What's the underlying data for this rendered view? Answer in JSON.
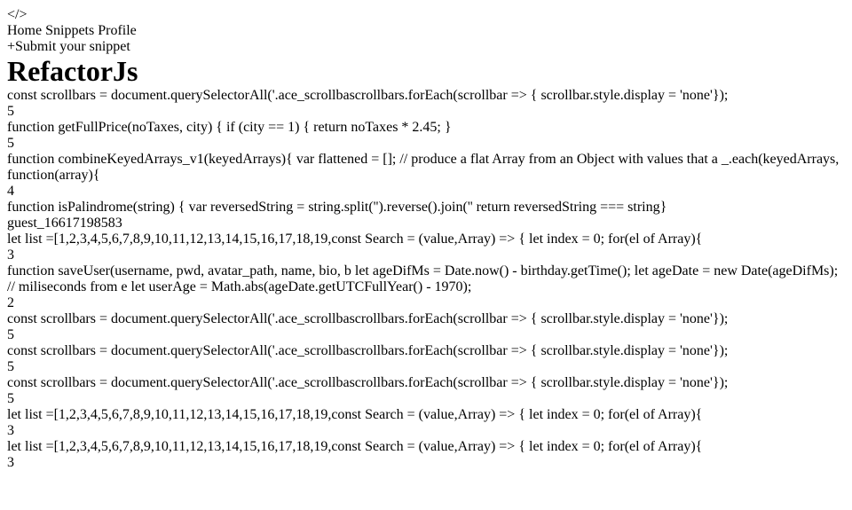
{
  "app": {
    "logo_glyph": "</>",
    "nav": [
      "Home",
      "Snippets",
      "Profile"
    ],
    "active_nav": "Home",
    "submit_button": "Submit your snippet",
    "page_title": "RefactorJs"
  },
  "colors": {
    "accent": "#4f46e5",
    "hero_bg": "#1f2937",
    "page_bg": "#e7e8eb",
    "keyword": "#1d4ed8",
    "string": "#047857",
    "number": "#b45309"
  },
  "snippets": [
    {
      "code": [
        [
          [
            "const ",
            "kw"
          ],
          [
            "scrollbars = ",
            ""
          ],
          [
            "document",
            "fn"
          ],
          [
            ".querySelectorAll('.ace_scrollba",
            ""
          ]
        ],
        [],
        [
          [
            "scrollbars.forEach(scrollbar => {",
            ""
          ]
        ],
        [
          [
            "  scrollbar.",
            ""
          ],
          [
            "style",
            "fn"
          ],
          [
            ".",
            ""
          ],
          [
            "display",
            "fn"
          ],
          [
            " = ",
            ""
          ],
          [
            "'none'",
            "str"
          ]
        ],
        [
          [
            "});",
            ""
          ]
        ]
      ],
      "author": "",
      "author_blurred": true,
      "comments": "5"
    },
    {
      "code": [
        [
          [
            "function ",
            "kw"
          ],
          [
            "getFullPrice",
            "fn"
          ],
          [
            "(",
            ""
          ],
          [
            "noTaxes, city",
            "fn"
          ],
          [
            ") {",
            ""
          ]
        ],
        [
          [
            "  if (city == 1) {",
            ""
          ]
        ],
        [
          [
            "    return ",
            "kw"
          ],
          [
            "noTaxes * ",
            ""
          ],
          [
            "2.45",
            "num"
          ],
          [
            ";",
            ""
          ]
        ],
        [
          [
            "  }",
            ""
          ]
        ]
      ],
      "author": "",
      "author_blurred": true,
      "comments": "5"
    },
    {
      "code": [
        [
          [
            "function ",
            "kw"
          ],
          [
            "combineKeyedArrays_v1",
            "fn"
          ],
          [
            "(",
            ""
          ],
          [
            "keyedArrays",
            "fn"
          ],
          [
            "){",
            ""
          ]
        ],
        [
          [
            "  var ",
            "kw"
          ],
          [
            "flattened = [];",
            ""
          ]
        ],
        [],
        [
          [
            "  // produce a flat Array from an Object with values that a",
            "cm"
          ]
        ],
        [
          [
            "  _.each(keyedArrays, ",
            ""
          ],
          [
            "function",
            "kw"
          ],
          [
            "(array){",
            ""
          ]
        ]
      ],
      "author": "",
      "author_blurred": true,
      "comments": "4"
    },
    {
      "code": [
        [
          [
            "function ",
            "kw"
          ],
          [
            "isPalindrome",
            "fn"
          ],
          [
            "(",
            ""
          ],
          [
            "string",
            "fn"
          ],
          [
            ") {",
            ""
          ]
        ],
        [
          [
            "    var ",
            "kw"
          ],
          [
            "reversedString = string.",
            ""
          ],
          [
            "split",
            "fn"
          ],
          [
            "('').",
            ""
          ],
          [
            "reverse",
            "fn"
          ],
          [
            "().",
            ""
          ],
          [
            "join",
            "fn"
          ],
          [
            "(''",
            ""
          ]
        ],
        [
          [
            "    return ",
            "kw"
          ],
          [
            "reversedString === string",
            ""
          ]
        ],
        [
          [
            "}",
            ""
          ]
        ]
      ],
      "author": "guest_1661719858",
      "author_blurred": false,
      "comments": "3"
    },
    {
      "code": [
        [
          [
            "let ",
            "kw"
          ],
          [
            "list =[",
            ""
          ],
          [
            "1,2,3,4,5,6,7,8,9,10,11,12,13,14,15,16,17,18,19,",
            "num"
          ]
        ],
        [],
        [
          [
            "const ",
            "kw"
          ],
          [
            "Search = (value,",
            ""
          ],
          [
            "Array",
            "fn"
          ],
          [
            ") => {",
            ""
          ]
        ],
        [
          [
            " let ",
            "kw"
          ],
          [
            "index = ",
            ""
          ],
          [
            "0",
            "num"
          ],
          [
            ";",
            ""
          ]
        ],
        [
          [
            "  for(el ",
            ""
          ],
          [
            "of ",
            "kw"
          ],
          [
            "Array",
            "fn"
          ],
          [
            "){",
            ""
          ]
        ]
      ],
      "author": "",
      "author_blurred": true,
      "comments": "3"
    },
    {
      "code": [
        [
          [
            "  function ",
            "kw"
          ],
          [
            "saveUser",
            "fn"
          ],
          [
            "(",
            ""
          ],
          [
            "username, pwd, avatar_path, name, bio, b",
            "fn"
          ]
        ],
        [
          [
            "    let ",
            "kw"
          ],
          [
            "ageDifMs = ",
            ""
          ],
          [
            "Date",
            "fn"
          ],
          [
            ".now() - birthday.",
            ""
          ],
          [
            "getTime",
            "fn"
          ],
          [
            "();",
            ""
          ]
        ],
        [
          [
            "    let ",
            "kw"
          ],
          [
            "ageDate = ",
            ""
          ],
          [
            "new ",
            "kw"
          ],
          [
            "Date",
            "fn"
          ],
          [
            "(ageDifMs); ",
            ""
          ],
          [
            "// miliseconds from e",
            "cm"
          ]
        ],
        [
          [
            "    let ",
            "kw"
          ],
          [
            "userAge = ",
            ""
          ],
          [
            "Math",
            "fn"
          ],
          [
            ".",
            ""
          ],
          [
            "abs",
            "fn"
          ],
          [
            "(ageDate.",
            ""
          ],
          [
            "getUTCFullYear",
            "fn"
          ],
          [
            "() - ",
            ""
          ],
          [
            "1970",
            "num"
          ],
          [
            ");",
            ""
          ]
        ]
      ],
      "author": "",
      "author_blurred": true,
      "comments": "2"
    },
    {
      "code": [
        [
          [
            "const ",
            "kw"
          ],
          [
            "scrollbars = ",
            ""
          ],
          [
            "document",
            "fn"
          ],
          [
            ".querySelectorAll('.ace_scrollba",
            ""
          ]
        ],
        [],
        [
          [
            "scrollbars.forEach(scrollbar => {",
            ""
          ]
        ],
        [
          [
            "  scrollbar.",
            ""
          ],
          [
            "style",
            "fn"
          ],
          [
            ".",
            ""
          ],
          [
            "display",
            "fn"
          ],
          [
            " = ",
            ""
          ],
          [
            "'none'",
            "str"
          ]
        ],
        [
          [
            "});",
            ""
          ]
        ]
      ],
      "author": "",
      "author_blurred": true,
      "comments": "5"
    },
    {
      "code": [
        [
          [
            "const ",
            "kw"
          ],
          [
            "scrollbars = ",
            ""
          ],
          [
            "document",
            "fn"
          ],
          [
            ".querySelectorAll('.ace_scrollba",
            ""
          ]
        ],
        [],
        [
          [
            "scrollbars.forEach(scrollbar => {",
            ""
          ]
        ],
        [
          [
            "  scrollbar.",
            ""
          ],
          [
            "style",
            "fn"
          ],
          [
            ".",
            ""
          ],
          [
            "display",
            "fn"
          ],
          [
            " = ",
            ""
          ],
          [
            "'none'",
            "str"
          ]
        ],
        [
          [
            "});",
            ""
          ]
        ]
      ],
      "author": "",
      "author_blurred": true,
      "comments": "5"
    },
    {
      "code": [
        [
          [
            "const ",
            "kw"
          ],
          [
            "scrollbars = ",
            ""
          ],
          [
            "document",
            "fn"
          ],
          [
            ".querySelectorAll('.ace_scrollba",
            ""
          ]
        ],
        [],
        [
          [
            "scrollbars.forEach(scrollbar => {",
            ""
          ]
        ],
        [
          [
            "  scrollbar.",
            ""
          ],
          [
            "style",
            "fn"
          ],
          [
            ".",
            ""
          ],
          [
            "display",
            "fn"
          ],
          [
            " = ",
            ""
          ],
          [
            "'none'",
            "str"
          ]
        ],
        [
          [
            "});",
            ""
          ]
        ]
      ],
      "author": "",
      "author_blurred": true,
      "comments": "5"
    },
    {
      "code": [
        [
          [
            "let ",
            "kw"
          ],
          [
            "list =[",
            ""
          ],
          [
            "1,2,3,4,5,6,7,8,9,10,11,12,13,14,15,16,17,18,19,",
            "num"
          ]
        ],
        [],
        [
          [
            "const ",
            "kw"
          ],
          [
            "Search = (value,",
            ""
          ],
          [
            "Array",
            "fn"
          ],
          [
            ") => {",
            ""
          ]
        ],
        [
          [
            " let ",
            "kw"
          ],
          [
            "index = ",
            ""
          ],
          [
            "0",
            "num"
          ],
          [
            ";",
            ""
          ]
        ],
        [
          [
            "  for(el ",
            ""
          ],
          [
            "of ",
            "kw"
          ],
          [
            "Array",
            "fn"
          ],
          [
            "){",
            ""
          ]
        ]
      ],
      "author": "",
      "author_blurred": true,
      "comments": "3"
    },
    {
      "code": [
        [
          [
            "let ",
            "kw"
          ],
          [
            "list =[",
            ""
          ],
          [
            "1,2,3,4,5,6,7,8,9,10,11,12,13,14,15,16,17,18,19,",
            "num"
          ]
        ],
        [],
        [
          [
            "const ",
            "kw"
          ],
          [
            "Search = (value,",
            ""
          ],
          [
            "Array",
            "fn"
          ],
          [
            ") => {",
            ""
          ]
        ],
        [
          [
            " let ",
            "kw"
          ],
          [
            "index = ",
            ""
          ],
          [
            "0",
            "num"
          ],
          [
            ";",
            ""
          ]
        ],
        [
          [
            "  for(el ",
            ""
          ],
          [
            "of ",
            "kw"
          ],
          [
            "Array",
            "fn"
          ],
          [
            "){",
            ""
          ]
        ]
      ],
      "author": "",
      "author_blurred": true,
      "comments": "3"
    }
  ]
}
